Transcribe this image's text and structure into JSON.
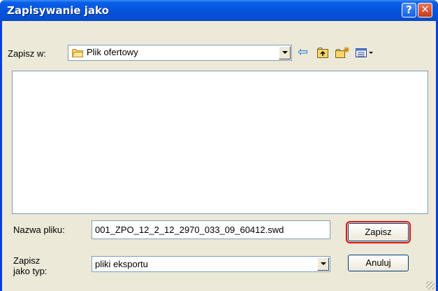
{
  "window": {
    "title": "Zapisywanie jako",
    "help_glyph": "?",
    "close_glyph": "✕"
  },
  "location": {
    "label": "Zapisz w:",
    "value": "Plik ofertowy",
    "icon": "folder-icon"
  },
  "toolbar": {
    "back_icon": "back-arrow-icon",
    "up_icon": "up-folder-icon",
    "new_folder_icon": "new-folder-icon",
    "view_icon": "view-menu-icon",
    "back_glyph": "⇦"
  },
  "filename": {
    "label": "Nazwa pliku:",
    "value": "001_ZPO_12_2_12_2970_033_09_60412.swd"
  },
  "filetype": {
    "label": "Zapisz jako typ:",
    "value": "pliki eksportu"
  },
  "buttons": {
    "save": "Zapisz",
    "cancel": "Anuluj"
  },
  "colors": {
    "highlight": "#e01010",
    "titlebar": "#0654dc"
  }
}
